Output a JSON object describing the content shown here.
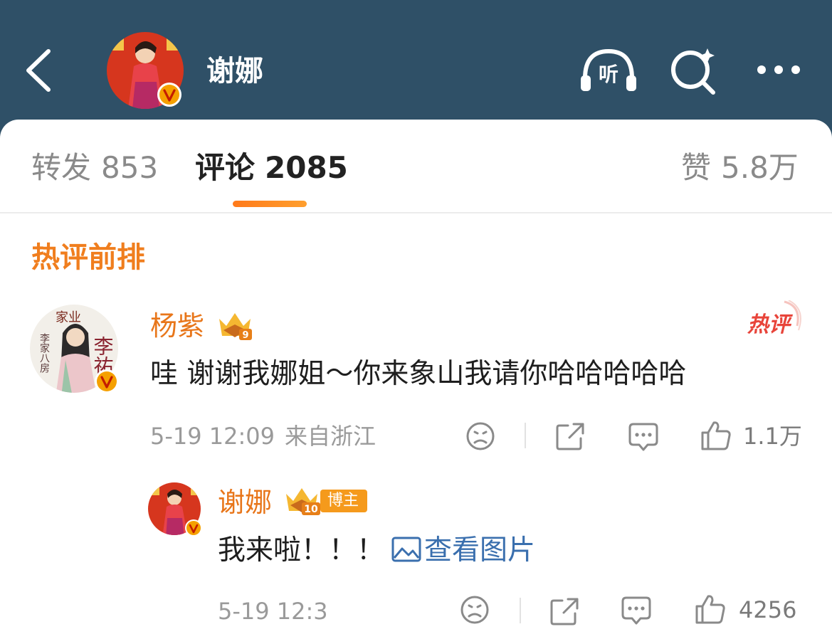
{
  "header": {
    "title": "谢娜",
    "listen_label": "听",
    "icons": [
      "back-icon",
      "listen-icon",
      "search-icon",
      "more-icon"
    ]
  },
  "tabs": [
    {
      "label": "转发",
      "count": "853"
    },
    {
      "label": "评论",
      "count": "2085"
    },
    {
      "label": "赞",
      "count": "5.8万"
    }
  ],
  "section_title": "热评前排",
  "comments": [
    {
      "user": "杨紫",
      "level": "9",
      "hot_label": "热评",
      "avatar_text": {
        "top": "家业",
        "name_big": "李祐",
        "side": "李家八房"
      },
      "text": "哇 谢谢我娜姐～你来象山我请你哈哈哈哈哈",
      "time": "5-19 12:09",
      "location": "来自浙江",
      "likes": "1.1万"
    },
    {
      "user": "谢娜",
      "level": "10",
      "tag": "博主",
      "text": "我来啦！！！",
      "link": "查看图片",
      "time": "5-19 12:3",
      "likes": "4256"
    }
  ],
  "colors": {
    "header_bg": "#2f5067",
    "accent": "#f07e1e",
    "link": "#3a6fae"
  }
}
